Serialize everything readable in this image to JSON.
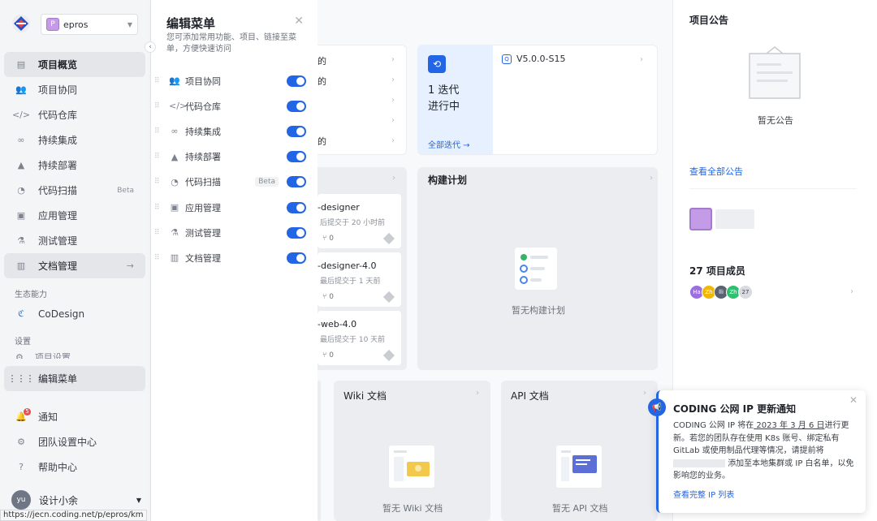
{
  "sidebar": {
    "project": "epros",
    "items": [
      {
        "label": "项目概览",
        "icon": "overview-icon"
      },
      {
        "label": "项目协同",
        "icon": "team-icon"
      },
      {
        "label": "代码仓库",
        "icon": "code-icon"
      },
      {
        "label": "持续集成",
        "icon": "infinity-icon"
      },
      {
        "label": "持续部署",
        "icon": "rocket-icon"
      },
      {
        "label": "代码扫描",
        "icon": "pie-icon",
        "badge": "Beta"
      },
      {
        "label": "应用管理",
        "icon": "box-icon"
      },
      {
        "label": "测试管理",
        "icon": "flask-icon"
      },
      {
        "label": "文档管理",
        "icon": "doc-icon"
      }
    ],
    "section_ecosystem": "生态能力",
    "codesign": "CoDesign",
    "section_settings": "设置",
    "settings_partial": "项目设置",
    "edit_menu": "编辑菜单",
    "notify": "通知",
    "notify_count": "5",
    "team_settings": "团队设置中心",
    "help": "帮助中心",
    "user_initials": "yu",
    "user_name": "设计小余",
    "status_url": "https://jecn.coding.net/p/epros/km"
  },
  "edit_panel": {
    "title": "编辑菜单",
    "description": "您可添加常用功能、项目、链接至菜单，方便快速访问",
    "items": [
      {
        "label": "项目协同",
        "on": true
      },
      {
        "label": "代码仓库",
        "on": true
      },
      {
        "label": "持续集成",
        "on": true
      },
      {
        "label": "持续部署",
        "on": true
      },
      {
        "label": "代码扫描",
        "on": true,
        "badge": "Beta"
      },
      {
        "label": "应用管理",
        "on": true
      },
      {
        "label": "测试管理",
        "on": true
      },
      {
        "label": "文档管理",
        "on": true
      }
    ]
  },
  "main": {
    "partial_rows": [
      "的",
      "的",
      "的"
    ],
    "iteration_count": "1 迭代",
    "iteration_status": "进行中",
    "all_iterations": "全部迭代 →",
    "version": "V5.0.0-S15",
    "repos": [
      {
        "name": "-designer",
        "meta": "后提交于 20 小时前",
        "pr": "0"
      },
      {
        "name": "-designer-4.0",
        "meta": "最后提交于 1 天前",
        "pr": "0"
      },
      {
        "name": "-web-4.0",
        "meta": "最后提交于 10 天前",
        "pr": "0"
      }
    ],
    "build_title": "构建计划",
    "build_empty": "暂无构建计划",
    "wiki_title": "Wiki 文档",
    "wiki_empty": "暂无 Wiki 文档",
    "api_title": "API 文档",
    "api_empty": "暂无 API 文档"
  },
  "right": {
    "announce_title": "项目公告",
    "announce_empty": "暂无公告",
    "announce_link": "查看全部公告",
    "members_title": "27 项目成员",
    "members": [
      {
        "initials": "Ha",
        "color": "#9b6fe0"
      },
      {
        "initials": "Zh",
        "color": "#f2b705"
      },
      {
        "initials": "lli",
        "color": "#5a6270"
      },
      {
        "initials": "Zh",
        "color": "#2fbf71"
      },
      {
        "initials": "27",
        "color": "#d9dbe0"
      }
    ]
  },
  "notification": {
    "title": "CODING 公网 IP 更新通知",
    "body_a": "CODING 公网 IP 将在",
    "body_date": " 2023 年 3 月 6 日",
    "body_b": "进行更新。若您的团队存在使用 K8s 账号、绑定私有 GitLab 或使用制品代理等情况，请提前将",
    "body_c": "添加至本地集群或 IP 白名单，以免影响您的业务。",
    "link": "查看完整 IP 列表"
  },
  "colors": {
    "primary": "#2266e5",
    "badge": "#f04b4b"
  }
}
